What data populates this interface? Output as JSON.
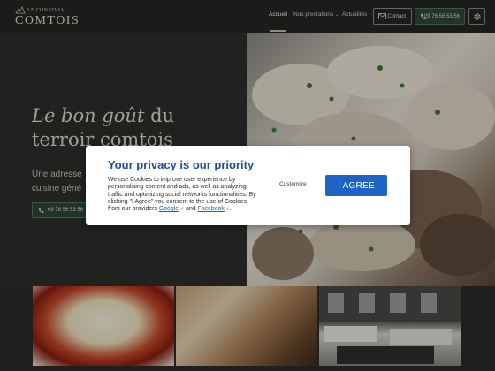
{
  "header": {
    "logo_top": "LE CONVIVIAL",
    "logo_bottom": "COMTOIS",
    "nav": [
      {
        "label": "Accueil"
      },
      {
        "label": "Nos prestations"
      },
      {
        "label": "Actualités"
      }
    ],
    "contact_label": "Contact",
    "phone_label": "09 76 56 53 56"
  },
  "hero": {
    "title_italic": "Le bon goût",
    "title_rest": " du",
    "title_line2": "terroir comtois",
    "text_line1": "Une adresse",
    "text_line2": "cuisine géné",
    "phone_button": "09 76 56 53 56"
  },
  "cookie_modal": {
    "title": "Your privacy is our priority",
    "body": "We use Cookies to improve user experience by personalising content and ads, as well as analyzing traffic and optimizing social networks functionalities. By clicking \"I Agree\" you consent to the use of Cookies from our providers",
    "link_google": "Google",
    "and": "and",
    "link_facebook": "Facebook",
    "period": ".",
    "customize_label": "Customize",
    "agree_label": "I AGREE"
  },
  "colors": {
    "accent_blue": "#1f63c4",
    "title_blue": "#1d4e9a",
    "phone_green": "#2c4a3a"
  }
}
